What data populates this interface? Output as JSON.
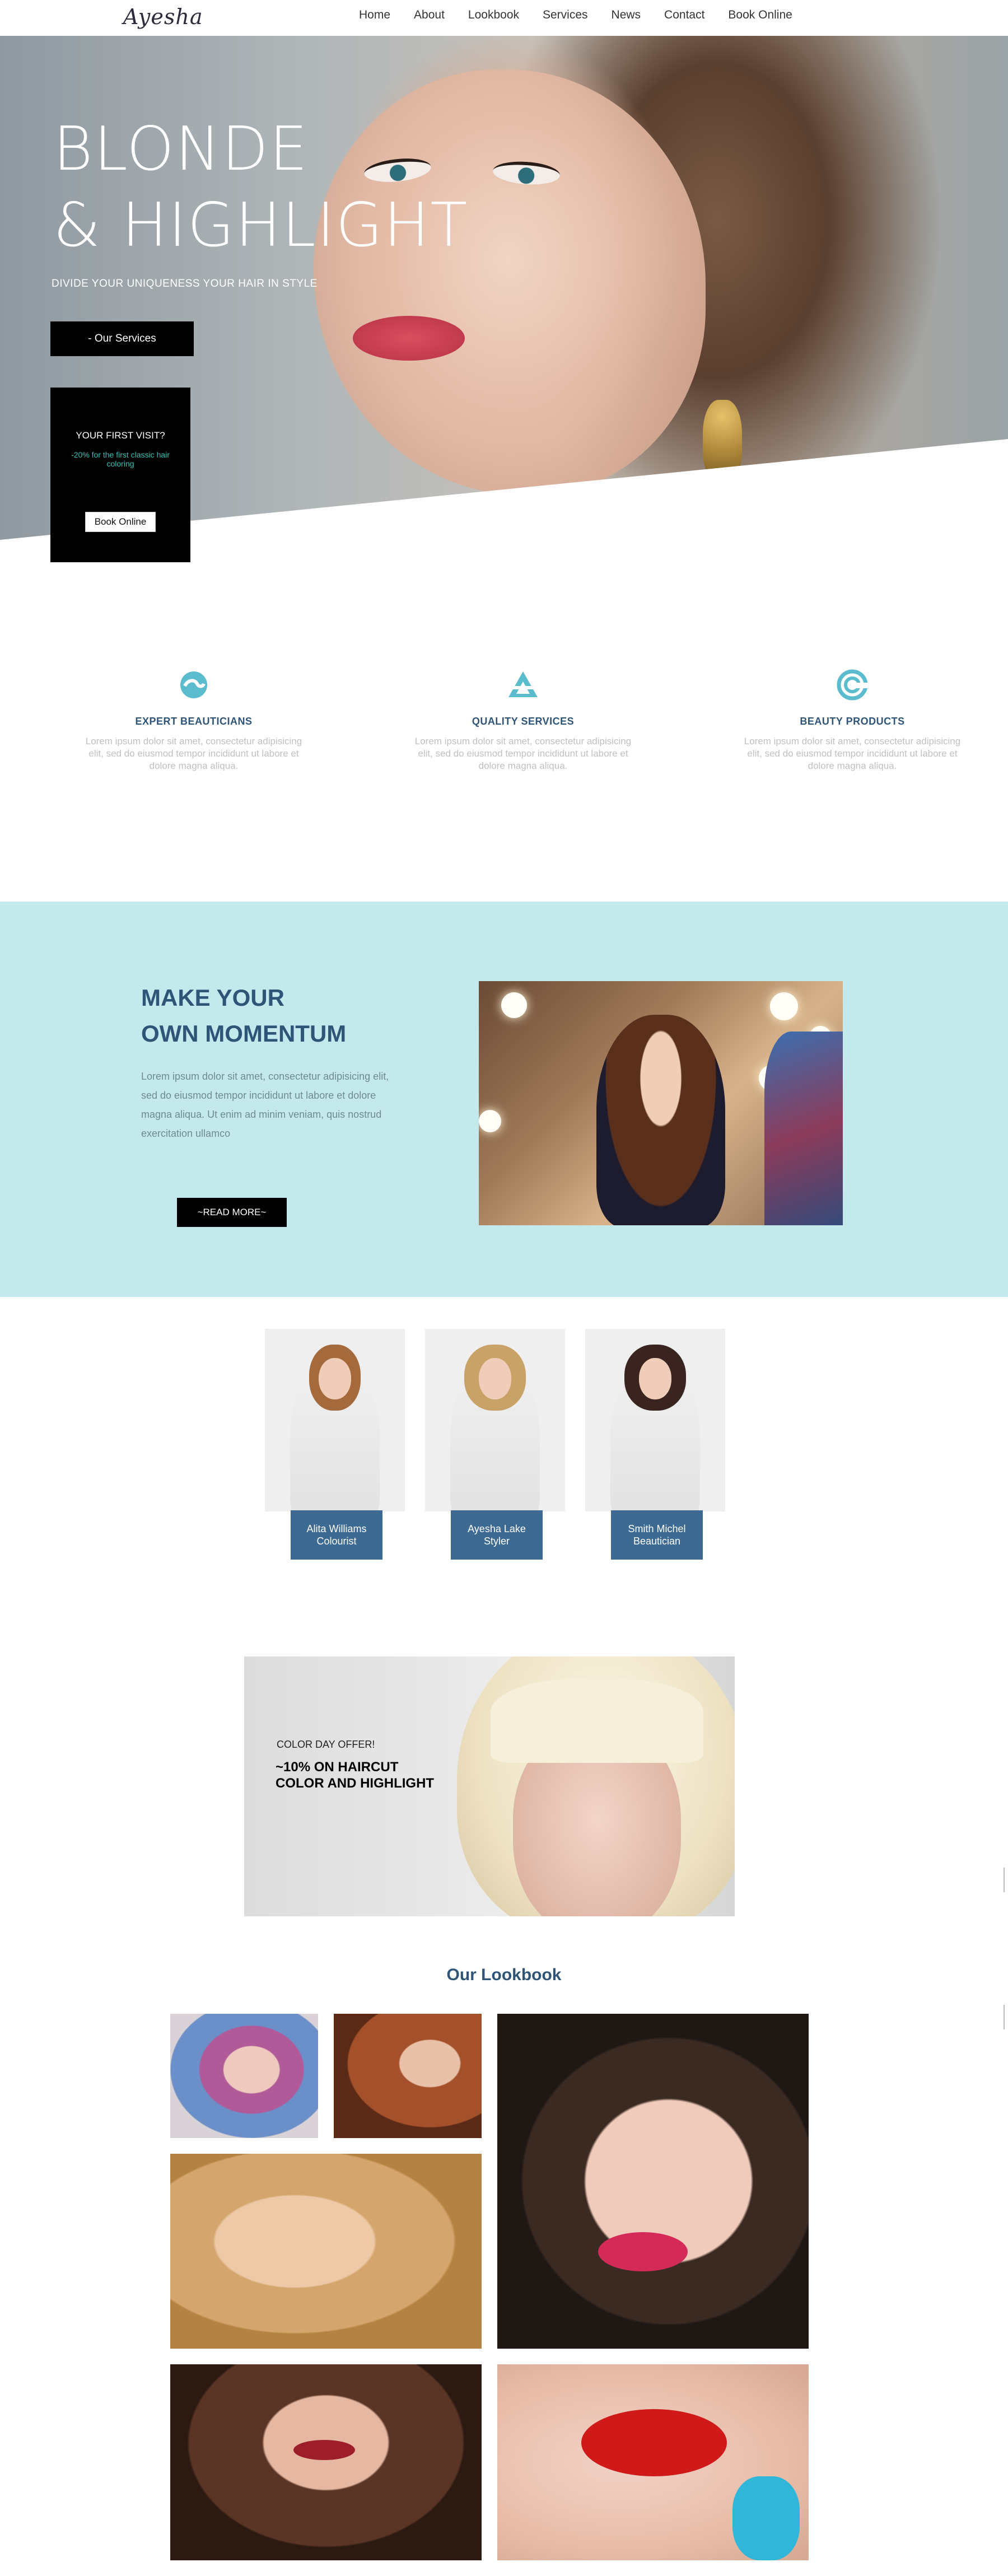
{
  "nav": {
    "logo": "Ayesha",
    "items": [
      "Home",
      "About",
      "Lookbook",
      "Services",
      "News",
      "Contact",
      "Book Online"
    ]
  },
  "hero": {
    "title_line1": "BLONDE",
    "title_line2": "& HIGHLIGHT",
    "subtitle": "DIVIDE YOUR UNIQUENESS YOUR HAIR IN STYLE",
    "services_button": "- Our Services",
    "visit": {
      "title": "YOUR FIRST VISIT?",
      "note": "-20% for the first classic hair coloring",
      "button": "Book Online"
    }
  },
  "features": [
    {
      "icon": "wave-icon",
      "title": "EXPERT BEAUTICIANS",
      "text": "Lorem ipsum dolor sit amet, consectetur adipisicing elit, sed do eiusmod tempor incididunt ut labore et dolore magna aliqua."
    },
    {
      "icon": "triangle-icon",
      "title": "QUALITY SERVICES",
      "text": "Lorem ipsum dolor sit amet, consectetur adipisicing elit, sed do eiusmod tempor incididunt ut labore et dolore magna aliqua."
    },
    {
      "icon": "spiral-icon",
      "title": "BEAUTY PRODUCTS",
      "text": "Lorem ipsum dolor sit amet, consectetur adipisicing elit, sed do eiusmod tempor incididunt ut labore et dolore magna aliqua."
    }
  ],
  "momentum": {
    "title_line1": "MAKE YOUR",
    "title_line2": "OWN MOMENTUM",
    "text": "Lorem ipsum dolor sit amet, consectetur adipisicing elit, sed do eiusmod tempor incididunt ut labore et dolore magna aliqua. Ut enim ad minim veniam, quis nostrud exercitation ullamco",
    "button": "~READ MORE~"
  },
  "team": [
    {
      "name": "Alita Williams",
      "role": "Colourist"
    },
    {
      "name": "Ayesha Lake",
      "role": "Styler"
    },
    {
      "name": "Smith Michel",
      "role": "Beautician"
    }
  ],
  "offer": {
    "small": "COLOR DAY OFFER!",
    "line1": "~10% ON HAIRCUT",
    "line2": "COLOR AND HIGHLIGHT"
  },
  "lookbook": {
    "title": "Our Lookbook"
  },
  "colors": {
    "accent_blue": "#2e5478",
    "teal_bg": "#c4e9ec",
    "icon_teal": "#5bbccd",
    "promo_green": "#2ec4b6",
    "team_label": "#3d6a93"
  }
}
